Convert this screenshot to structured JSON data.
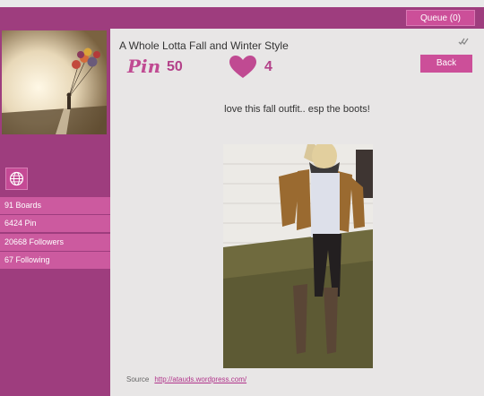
{
  "header": {
    "queue_label": "Queue (0)"
  },
  "sidebar": {
    "stats": [
      {
        "label": "91 Boards"
      },
      {
        "label": "6424 Pin"
      },
      {
        "label": "20668 Followers"
      },
      {
        "label": "67 Following"
      }
    ]
  },
  "pin": {
    "title": "A Whole Lotta Fall and Winter Style",
    "pin_logo": "Pin",
    "pin_count": "50",
    "like_count": "4",
    "back_label": "Back",
    "description": "love this fall outfit.. esp the boots!",
    "source_label": "Source",
    "source_url": "http://atauds.wordpress.com/"
  },
  "colors": {
    "sidebar": "#9e3d7e",
    "button": "#cc4f99",
    "stat_row": "#cc5a9f",
    "accent_text": "#b34189"
  },
  "icons": [
    "globe-icon",
    "heart-icon",
    "double-check-icon"
  ]
}
